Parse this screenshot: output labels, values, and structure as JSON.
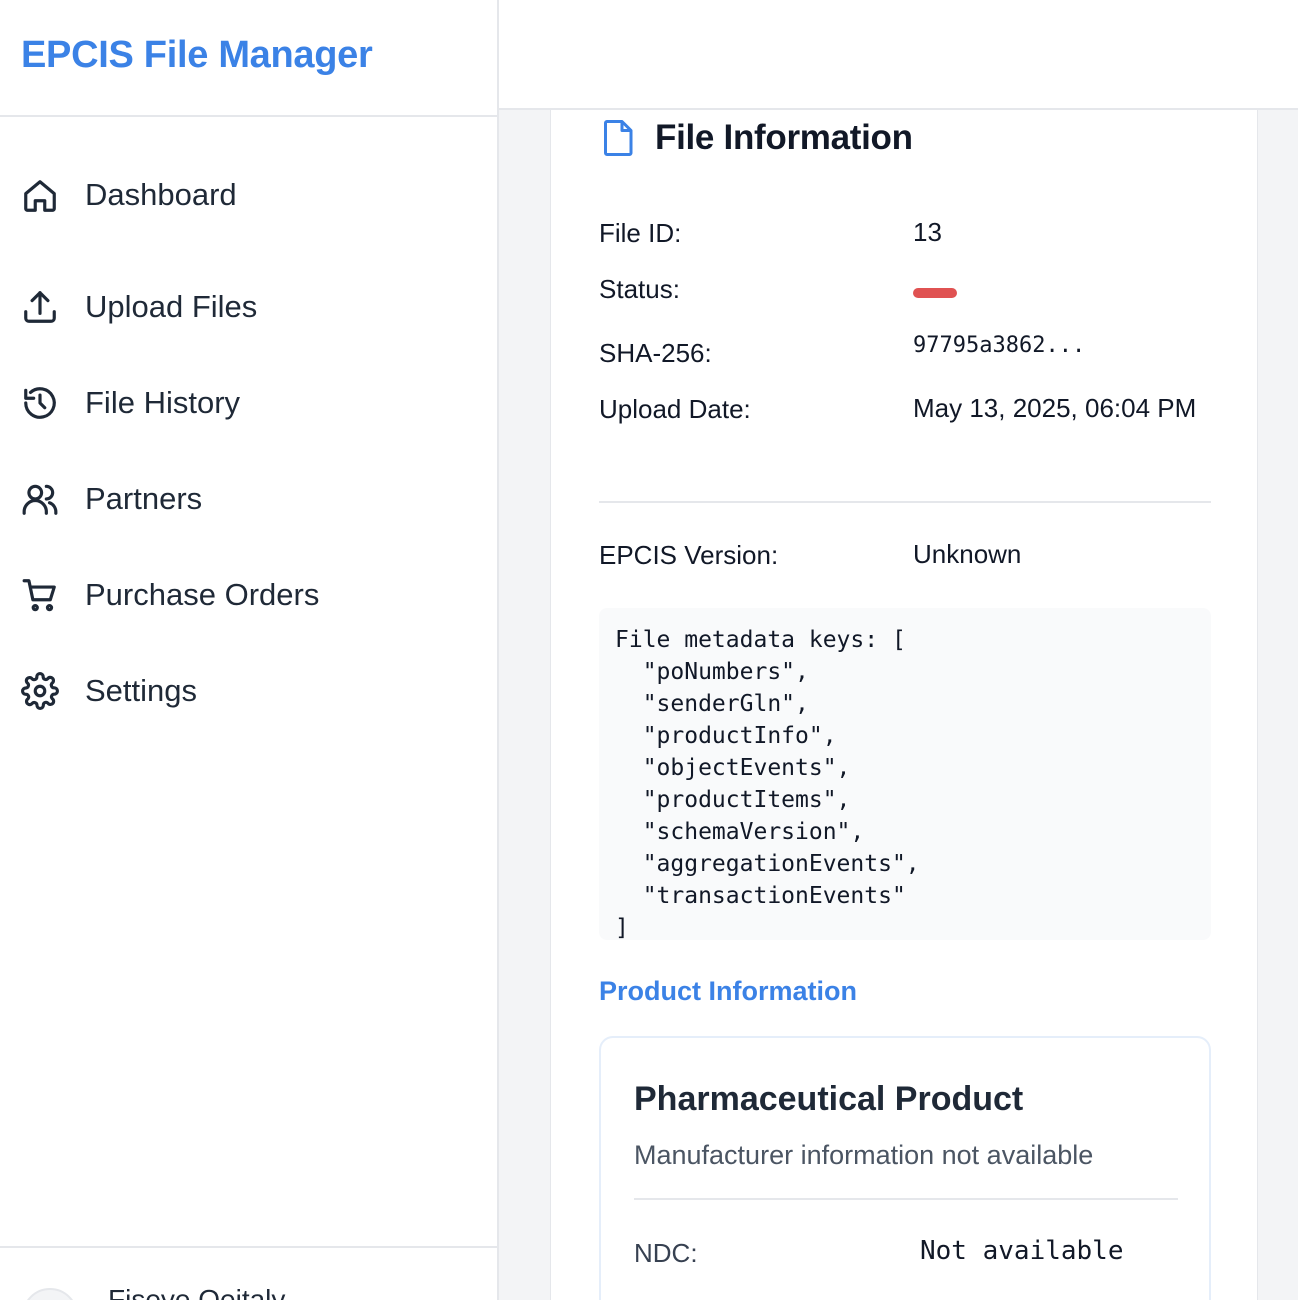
{
  "app": {
    "title": "EPCIS File Manager",
    "accent_color": "#3b82e6"
  },
  "sidebar": {
    "items": [
      {
        "label": "Dashboard",
        "icon": "home-icon"
      },
      {
        "label": "Upload Files",
        "icon": "upload-icon"
      },
      {
        "label": "File History",
        "icon": "history-icon"
      },
      {
        "label": "Partners",
        "icon": "users-icon"
      },
      {
        "label": "Purchase Orders",
        "icon": "cart-icon"
      },
      {
        "label": "Settings",
        "icon": "gear-icon"
      }
    ],
    "user": {
      "name": "Fiseye Oeitaly"
    }
  },
  "file_info": {
    "title": "File Information",
    "icon": "file-icon",
    "file_id_label": "File ID:",
    "file_id": "13",
    "status_label": "Status:",
    "status_color": "#e05252",
    "sha_label": "SHA-256:",
    "sha_value": "97795a3862...",
    "upload_date_label": "Upload Date:",
    "upload_date": "May 13, 2025, 06:04 PM",
    "epcis_version_label": "EPCIS Version:",
    "epcis_version": "Unknown",
    "metadata_text": "File metadata keys: [\n  \"poNumbers\",\n  \"senderGln\",\n  \"productInfo\",\n  \"objectEvents\",\n  \"productItems\",\n  \"schemaVersion\",\n  \"aggregationEvents\",\n  \"transactionEvents\"\n]"
  },
  "product_section": {
    "link_label": "Product Information",
    "card_title": "Pharmaceutical Product",
    "card_subtitle": "Manufacturer information not available",
    "ndc_label": "NDC:",
    "ndc_value": "Not available"
  }
}
